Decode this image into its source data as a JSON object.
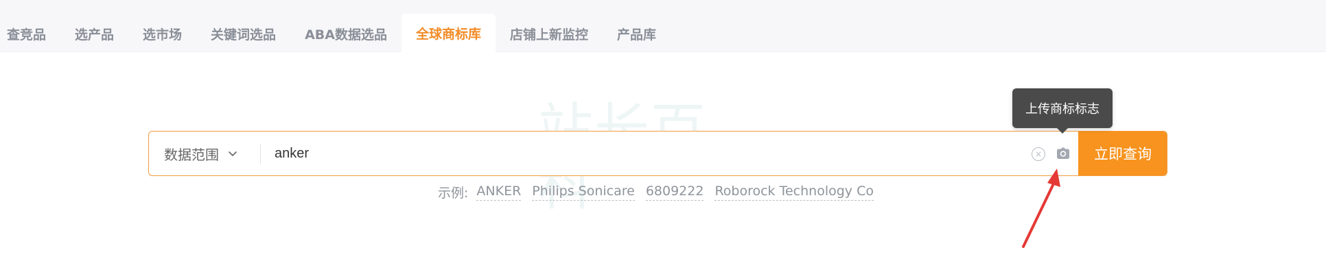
{
  "tabs": [
    {
      "label": "查竞品",
      "active": false
    },
    {
      "label": "选产品",
      "active": false
    },
    {
      "label": "选市场",
      "active": false
    },
    {
      "label": "关键词选品",
      "active": false
    },
    {
      "label": "ABA数据选品",
      "active": false
    },
    {
      "label": "全球商标库",
      "active": true
    },
    {
      "label": "店铺上新监控",
      "active": false
    },
    {
      "label": "产品库",
      "active": false
    }
  ],
  "watermark": "站长百科",
  "search": {
    "scope_label": "数据范围",
    "query": "anker",
    "submit_label": "立即查询"
  },
  "tooltip": "上传商标标志",
  "examples": {
    "label": "示例:",
    "items": [
      "ANKER",
      "Philips Sonicare",
      "6809222",
      "Roborock Technology Co"
    ]
  },
  "colors": {
    "accent": "#f7931e",
    "active_tab": "#f28c28",
    "arrow": "#e53935",
    "tooltip_bg": "#4a4a4a"
  },
  "icons": {
    "dropdown": "chevron-down-icon",
    "clear": "clear-circle-icon",
    "camera": "camera-icon",
    "pointer": "red-arrow"
  }
}
